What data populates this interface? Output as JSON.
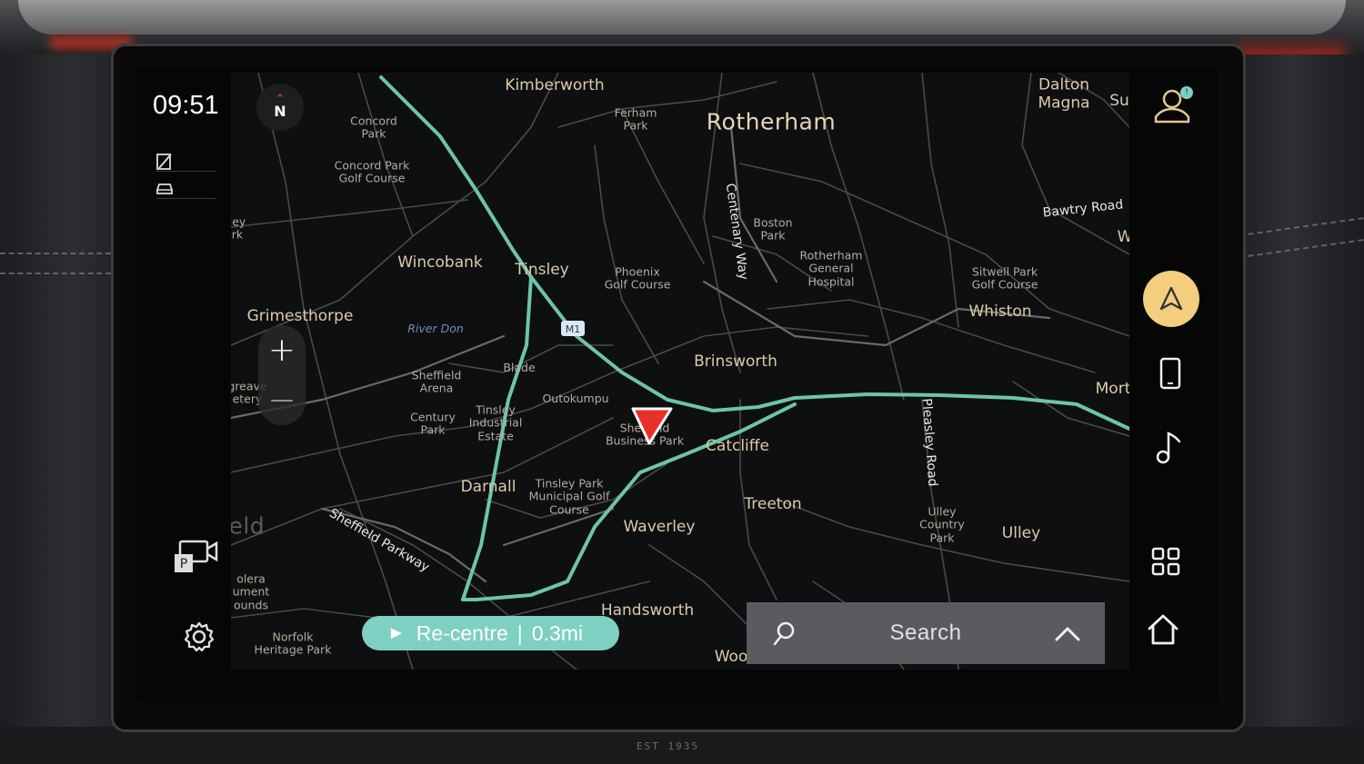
{
  "status": {
    "clock": "09:51"
  },
  "compass": {
    "label": "N"
  },
  "zoom": {
    "in_label": "+",
    "out_label": "—"
  },
  "map": {
    "labels": {
      "kimberworth": "Kimberworth",
      "ferham_park": "Ferham\nPark",
      "rotherham": "Rotherham",
      "dalton_magna": "Dalton\nMagna",
      "su": "Su",
      "concord_park": "Concord\nPark",
      "concord_golf": "Concord Park\nGolf Course",
      "ley_rk": "ley\nrk",
      "centenary_way": "Centenary Way",
      "boston_park": "Boston\nPark",
      "rotherham_hospital": "Rotherham\nGeneral\nHospital",
      "bawtry_road": "Bawtry Road",
      "w": "W",
      "wincobank": "Wincobank",
      "tinsley": "Tinsley",
      "phoenix_golf": "Phoenix\nGolf Course",
      "sitwell_golf": "Sitwell Park\nGolf Course",
      "whiston": "Whiston",
      "grimesthorpe": "Grimesthorpe",
      "river_don": "River Don",
      "brinsworth": "Brinsworth",
      "sheffield_arena": "Sheffield\nArena",
      "blade": "Blade",
      "greave_cemetery": "greave\netery",
      "outokumpu": "Outokumpu",
      "mort": "Mort",
      "tinsley_industrial": "Tinsley\nIndustrial\nEstate",
      "century_park": "Century\nPark",
      "sheffield_business_park": "Sheffield\nBusiness Park",
      "catcliffe": "Catcliffe",
      "pleasley_road": "Pleasley Road",
      "darnall": "Darnall",
      "tinsley_golf": "Tinsley Park\nMunicipal Golf\nCourse",
      "treeton": "Treeton",
      "ulley_country_park": "Ulley\nCountry\nPark",
      "sheffield": "Sheffield",
      "waverley": "Waverley",
      "ulley": "Ulley",
      "sheffield_parkway": "Sheffield Parkway",
      "olera": "olera\nument\nounds",
      "norfolk_heritage": "Norfolk\nHeritage Park",
      "handsworth": "Handsworth",
      "woo": "Woo",
      "motorway_shield": "M1"
    }
  },
  "recentre": {
    "label": "Re-centre",
    "distance": "0.3mi"
  },
  "search": {
    "label": "Search"
  },
  "colors": {
    "route": "#6ec4a8",
    "accent": "#f2ce7e",
    "recentre_bg": "#7ed0c2",
    "position_arrow": "#e8302a"
  },
  "icons": {
    "left": [
      "edit-icon",
      "car-icon",
      "camera-park-icon",
      "settings-icon"
    ],
    "right": [
      "user-icon",
      "navigation-icon",
      "phone-icon",
      "music-icon",
      "apps-grid-icon",
      "home-icon"
    ]
  }
}
